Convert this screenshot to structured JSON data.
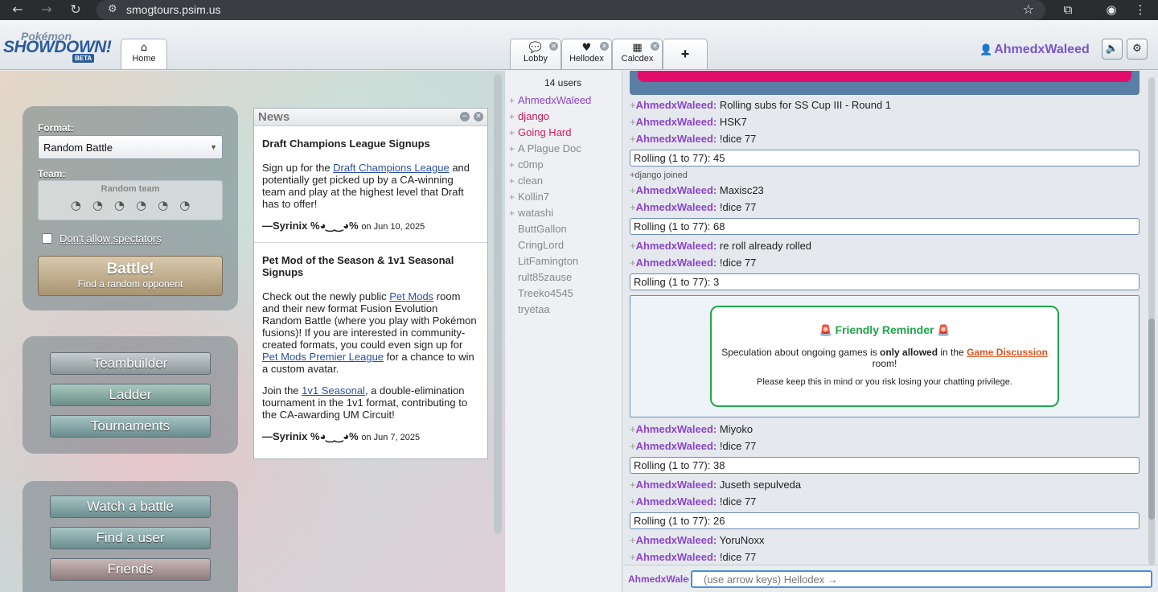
{
  "browser": {
    "url": "smogtours.psim.us"
  },
  "logo": {
    "line1": "Pokémon",
    "line2": "SHOWDOWN!",
    "badge": "BETA"
  },
  "tabs": [
    {
      "label": "Home",
      "icon": "home-icon"
    },
    {
      "label": "Lobby",
      "icon": "chat-bubble-icon"
    },
    {
      "label": "Hellodex",
      "icon": "heart-icon"
    },
    {
      "label": "Calcdex",
      "icon": "calculator-icon"
    },
    {
      "label": "+",
      "icon": "plus-icon"
    }
  ],
  "header": {
    "username": "AhmedxWaleed"
  },
  "battle_form": {
    "format_label": "Format:",
    "format_value": "Random Battle",
    "team_label": "Team:",
    "team_value": "Random team",
    "spectators_label": "Don't allow spectators",
    "battle_title": "Battle!",
    "battle_subtitle": "Find a random opponent"
  },
  "menu": {
    "teambuilder": "Teambuilder",
    "ladder": "Ladder",
    "tournaments": "Tournaments",
    "watch": "Watch a battle",
    "find_user": "Find a user",
    "friends": "Friends"
  },
  "news": {
    "title": "News",
    "items": [
      {
        "headline": "Draft Champions League Signups",
        "p1_pre": "Sign up for the ",
        "p1_link": "Draft Champions League",
        "p1_post": " and potentially get picked up by a CA-winning team and play at the highest level that Draft has to offer!",
        "author": "—Syrinix %◕‿‿◕%",
        "date": "on Jun 10, 2025"
      },
      {
        "headline": "Pet Mod of the Season & 1v1 Seasonal Signups",
        "p1_pre": "Check out the newly public ",
        "p1_link": "Pet Mods",
        "p1_mid": " room and their new format Fusion Evolution Random Battle (where you play with Pokémon fusions)! If you are interested in community-created formats, you could even sign up for ",
        "p1_link2": "Pet Mods Premier League",
        "p1_post": " for a chance to win a custom avatar.",
        "p2_pre": "Join the ",
        "p2_link": "1v1 Seasonal",
        "p2_post": ", a double-elimination tournament in the 1v1 format, contributing to the CA-awarding UM Circuit!",
        "author": "—Syrinix %◕‿‿◕%",
        "date": "on Jun 7, 2025"
      }
    ]
  },
  "userlist": {
    "count": "14 users",
    "users": [
      {
        "rank": "+",
        "name": "AhmedxWaleed",
        "color": "#8b45c9"
      },
      {
        "rank": "+",
        "name": "django",
        "color": "#c2185b"
      },
      {
        "rank": "+",
        "name": "Going Hard",
        "color": "#d81b60"
      },
      {
        "rank": "+",
        "name": "A Plague Doc",
        "color": "#888888"
      },
      {
        "rank": "+",
        "name": "c0mp",
        "color": "#888888"
      },
      {
        "rank": "+",
        "name": "clean",
        "color": "#888888"
      },
      {
        "rank": "+",
        "name": "Kollin7",
        "color": "#888888"
      },
      {
        "rank": "+",
        "name": "watashi",
        "color": "#888888"
      },
      {
        "rank": "",
        "name": "ButtGallon",
        "color": "#888888"
      },
      {
        "rank": "",
        "name": "CringLord",
        "color": "#888888"
      },
      {
        "rank": "",
        "name": "LitFamington",
        "color": "#888888"
      },
      {
        "rank": "",
        "name": "rult85zause",
        "color": "#888888"
      },
      {
        "rank": "",
        "name": "Treeko4545",
        "color": "#888888"
      },
      {
        "rank": "",
        "name": "tryetaa",
        "color": "#888888"
      }
    ]
  },
  "chat": {
    "user_prefix": "+",
    "name": "AhmedxWaleed:",
    "messages": [
      "Rolling subs for SS Cup III - Round 1",
      "HSK7",
      "!dice 77",
      "Maxisc23",
      "!dice 77",
      "re roll already rolled",
      "!dice 77",
      "Miyoko",
      "!dice 77",
      "Juseth sepulveda",
      "!dice 77",
      "YoruNoxx",
      "!dice 77"
    ],
    "rolls": [
      "Rolling (1 to 77): 45",
      "Rolling (1 to 77): 68",
      "Rolling (1 to 77): 3",
      "Rolling (1 to 77): 38",
      "Rolling (1 to 77): 26"
    ],
    "join": "+django joined",
    "reminder": {
      "title": "Friendly Reminder",
      "body_pre": "Speculation about ongoing games is ",
      "body_bold": "only allowed",
      "body_mid": " in the ",
      "body_link": "Game Discussion",
      "body_post": " room!",
      "note": "Please keep this in mind or you risk losing your chatting privilege."
    },
    "input_user": "AhmedxWaleed",
    "input_placeholder": "(use arrow keys) Hellodex →"
  }
}
